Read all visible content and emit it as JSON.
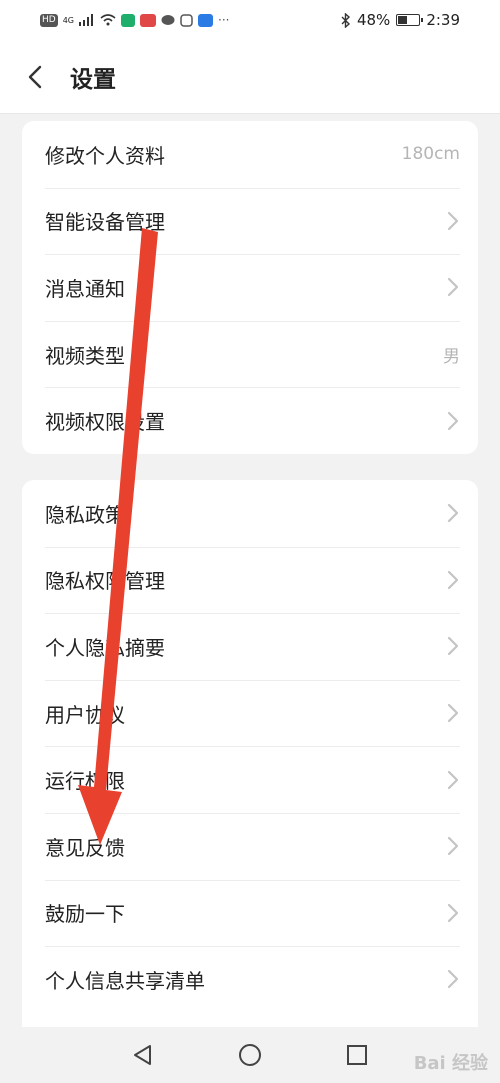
{
  "status_bar": {
    "left_chips": [
      "HD",
      "4G"
    ],
    "bluetooth_icon": "bluetooth-icon",
    "battery_percent_text": "48%",
    "battery_level": 0.48,
    "time": "2:39"
  },
  "header": {
    "back_icon": "chevron-left-icon",
    "title": "设置"
  },
  "section1": {
    "items": [
      {
        "label": "修改个人资料",
        "value": "180cm",
        "chevron": false
      },
      {
        "label": "智能设备管理",
        "value": "",
        "chevron": true
      },
      {
        "label": "消息通知",
        "value": "",
        "chevron": true
      },
      {
        "label": "视频类型",
        "value": "男",
        "chevron": false
      },
      {
        "label": "视频权限设置",
        "value": "",
        "chevron": true
      }
    ]
  },
  "section2": {
    "items": [
      {
        "label": "隐私政策",
        "chevron": true
      },
      {
        "label": "隐私权限管理",
        "chevron": true
      },
      {
        "label": "个人隐私摘要",
        "chevron": true
      },
      {
        "label": "用户协议",
        "chevron": true
      },
      {
        "label": "运行权限",
        "chevron": true
      },
      {
        "label": "意见反馈",
        "chevron": true
      },
      {
        "label": "鼓励一下",
        "chevron": true
      },
      {
        "label": "个人信息共享清单",
        "chevron": true
      }
    ]
  },
  "nav_bar": {
    "back_icon": "triangle-back-icon",
    "home_icon": "circle-home-icon",
    "recents_icon": "square-recents-icon"
  },
  "watermark": "Bai 经验",
  "annotation": {
    "color": "#e8412e"
  }
}
